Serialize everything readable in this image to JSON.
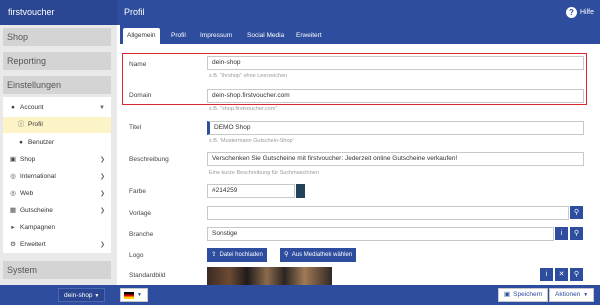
{
  "app": {
    "brand": "firstvoucher",
    "page_title": "Profil",
    "help_label": "Hilfe"
  },
  "sidebar": {
    "sections": {
      "shop": "Shop",
      "reporting": "Reporting",
      "einstellungen": "Einstellungen",
      "system": "System"
    },
    "items": [
      {
        "label": "Account"
      },
      {
        "label": "Profil"
      },
      {
        "label": "Benutzer"
      },
      {
        "label": "Shop"
      },
      {
        "label": "International"
      },
      {
        "label": "Web"
      },
      {
        "label": "Gutscheine"
      },
      {
        "label": "Kampagnen"
      },
      {
        "label": "Erweitert"
      }
    ]
  },
  "tabs": [
    {
      "label": "Allgemein"
    },
    {
      "label": "Profil"
    },
    {
      "label": "Impressum"
    },
    {
      "label": "Social Media"
    },
    {
      "label": "Erweitert"
    }
  ],
  "form": {
    "name": {
      "label": "Name",
      "value": "dein-shop",
      "hint": "z.B. \"ihrshop\" ohne Leerzeichen"
    },
    "domain": {
      "label": "Domain",
      "value": "dein-shop.firstvoucher.com",
      "hint": "z.B. \"shop.firstvoucher.com\""
    },
    "titel": {
      "label": "Titel",
      "value": "DEMO Shop",
      "hint": "z.B. 'Mustermann Gutschein-Shop'"
    },
    "beschreibung": {
      "label": "Beschreibung",
      "value": "Verschenken Sie Gutscheine mit firstvoucher: Jederzeit online Gutscheine verkaufen!",
      "hint": "Eine kurze Beschreibung für Suchmaschinen"
    },
    "farbe": {
      "label": "Farbe",
      "value": "#214259",
      "swatch_color": "#214259"
    },
    "vorlage": {
      "label": "Vorlage",
      "value": ""
    },
    "branche": {
      "label": "Branche",
      "value": "Sonstige"
    },
    "logo": {
      "label": "Logo",
      "upload_label": "Datei hochladen",
      "library_label": "Aus Mediathek wählen"
    },
    "standardbild": {
      "label": "Standardbild"
    }
  },
  "bottom": {
    "shop_select": "dein-shop",
    "save_label": "Speichern",
    "actions_label": "Aktionen"
  },
  "colors": {
    "primary": "#2e4d9e",
    "highlight": "#d9272e",
    "active_nav": "#fcf3c7"
  }
}
